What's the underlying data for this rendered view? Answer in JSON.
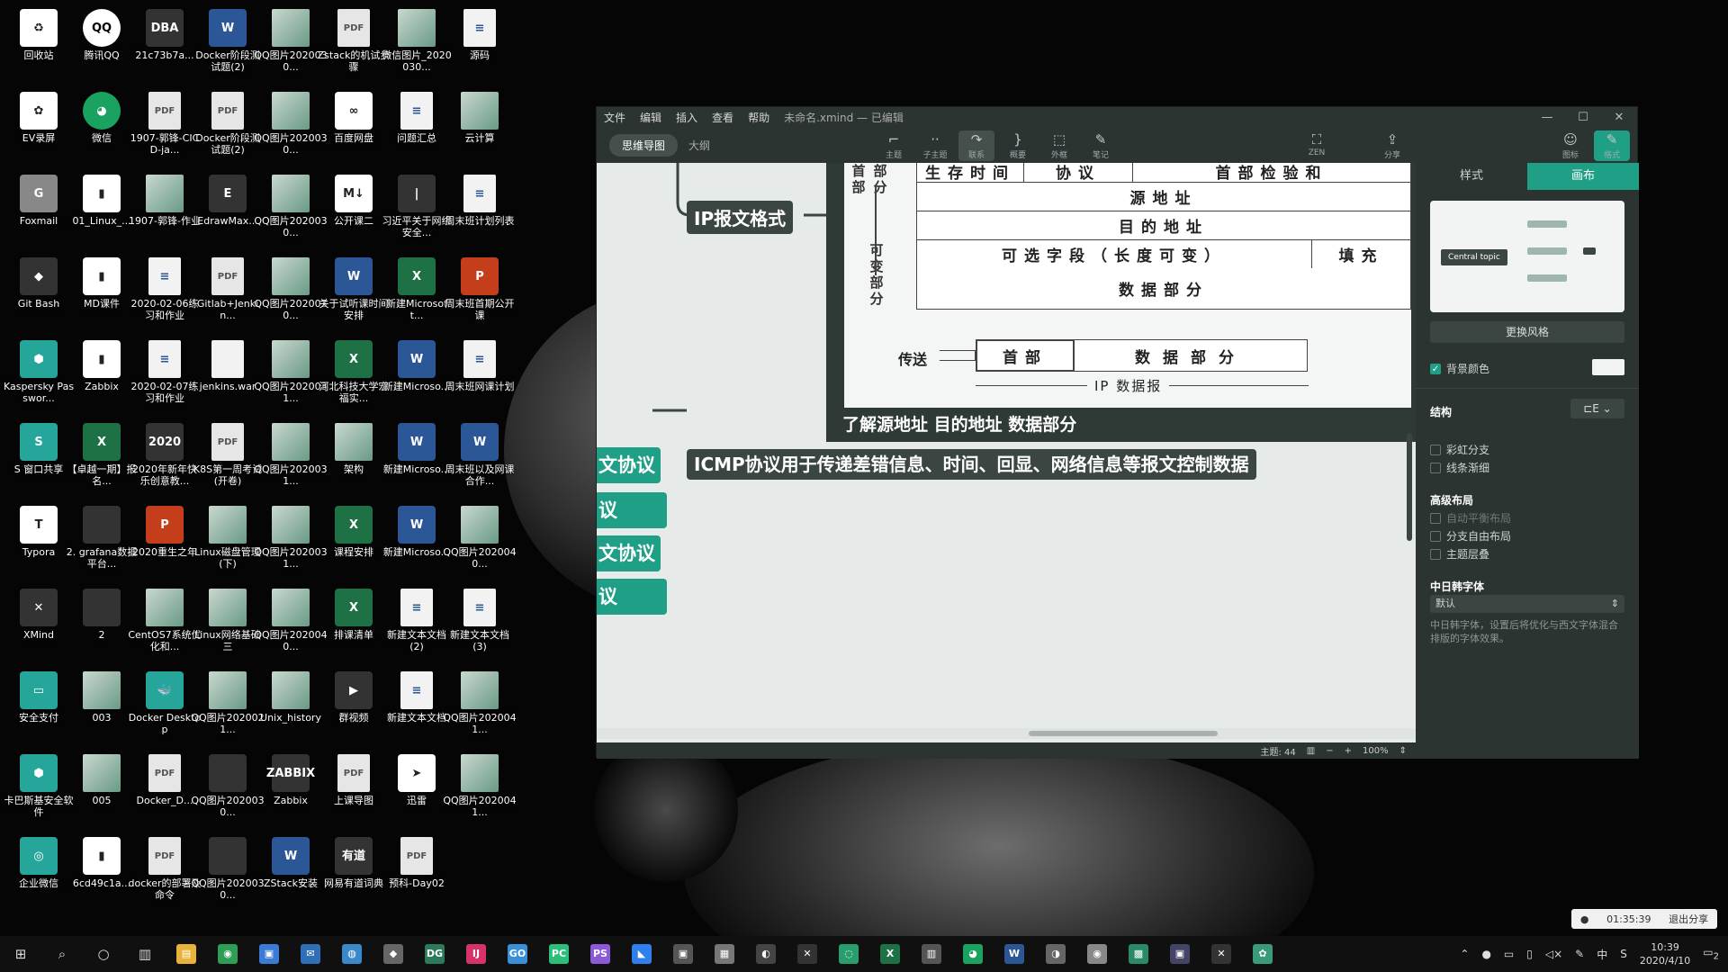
{
  "desktop_icons": [
    {
      "label": "回收站",
      "icon": "recycle-bin-icon",
      "kind": "white",
      "glyph": "♻"
    },
    {
      "label": "腾讯QQ",
      "icon": "qq-icon",
      "kind": "qq",
      "glyph": "QQ"
    },
    {
      "label": "21c73b7a...",
      "icon": "dba-icon",
      "kind": "dark",
      "glyph": "DBA"
    },
    {
      "label": "Docker阶段测试题(2)",
      "icon": "word-doc-icon",
      "kind": "word",
      "glyph": "W"
    },
    {
      "label": "QQ图片2020030...",
      "icon": "image-file-icon",
      "kind": "img",
      "glyph": ""
    },
    {
      "label": "Zstack的机试步骤",
      "icon": "pdf-icon",
      "kind": "pdf",
      "glyph": "PDF"
    },
    {
      "label": "微信图片_2020030...",
      "icon": "image-file-icon",
      "kind": "img",
      "glyph": ""
    },
    {
      "label": "源码",
      "icon": "text-file-icon",
      "kind": "doc",
      "glyph": "≡"
    },
    {
      "label": "EV录屏",
      "icon": "ev-recorder-icon",
      "kind": "white",
      "glyph": "✿"
    },
    {
      "label": "微信",
      "icon": "wechat-icon",
      "kind": "green",
      "glyph": "◕"
    },
    {
      "label": "1907-郭锋-CICD-ja...",
      "icon": "pdf-icon",
      "kind": "pdf",
      "glyph": "PDF"
    },
    {
      "label": "Docker阶段测试题(2)",
      "icon": "pdf-icon",
      "kind": "pdf",
      "glyph": "PDF"
    },
    {
      "label": "QQ图片2020030...",
      "icon": "image-file-icon",
      "kind": "img",
      "glyph": ""
    },
    {
      "label": "百度网盘",
      "icon": "baidu-netdisk-icon",
      "kind": "white",
      "glyph": "∞"
    },
    {
      "label": "问题汇总",
      "icon": "text-file-icon",
      "kind": "doc",
      "glyph": "≡"
    },
    {
      "label": "云计算",
      "icon": "image-file-icon",
      "kind": "img",
      "glyph": ""
    },
    {
      "label": "Foxmail",
      "icon": "foxmail-icon",
      "kind": "gray",
      "glyph": "G"
    },
    {
      "label": "01_Linux_...",
      "icon": "file-icon",
      "kind": "white",
      "glyph": "▮"
    },
    {
      "label": "1907-郭锋-作业",
      "icon": "image-file-icon",
      "kind": "img",
      "glyph": ""
    },
    {
      "label": "EdrawMax...",
      "icon": "edrawmax-icon",
      "kind": "dark",
      "glyph": "E"
    },
    {
      "label": "QQ图片2020030...",
      "icon": "image-file-icon",
      "kind": "img",
      "glyph": ""
    },
    {
      "label": "公开课二",
      "icon": "markdown-icon",
      "kind": "white",
      "glyph": "M↓"
    },
    {
      "label": "习近平关于网络安全...",
      "icon": "file-icon",
      "kind": "dark",
      "glyph": "|"
    },
    {
      "label": "周末班计划列表",
      "icon": "text-file-icon",
      "kind": "doc",
      "glyph": "≡"
    },
    {
      "label": "Git Bash",
      "icon": "git-bash-icon",
      "kind": "dark",
      "glyph": "◆"
    },
    {
      "label": "MD课件",
      "icon": "file-icon",
      "kind": "white",
      "glyph": "▮"
    },
    {
      "label": "2020-02-06练习和作业",
      "icon": "text-file-icon",
      "kind": "doc",
      "glyph": "≡"
    },
    {
      "label": "Gitlab+Jenkin...",
      "icon": "pdf-icon",
      "kind": "pdf",
      "glyph": "PDF"
    },
    {
      "label": "QQ图片2020030...",
      "icon": "image-file-icon",
      "kind": "img",
      "glyph": ""
    },
    {
      "label": "关于试听课时间安排",
      "icon": "word-doc-icon",
      "kind": "word",
      "glyph": "W"
    },
    {
      "label": "新建Microsoft...",
      "icon": "excel-icon",
      "kind": "excel",
      "glyph": "X"
    },
    {
      "label": "周末班首期公开课",
      "icon": "ppt-icon",
      "kind": "ppt",
      "glyph": "P"
    },
    {
      "label": "Kaspersky Passwor...",
      "icon": "kaspersky-icon",
      "kind": "teal",
      "glyph": "⬢"
    },
    {
      "label": "Zabbix",
      "icon": "file-icon",
      "kind": "white",
      "glyph": "▮"
    },
    {
      "label": "2020-02-07练习和作业",
      "icon": "text-file-icon",
      "kind": "doc",
      "glyph": "≡"
    },
    {
      "label": "jenkins.war",
      "icon": "file-icon",
      "kind": "doc",
      "glyph": ""
    },
    {
      "label": "QQ图片2020031...",
      "icon": "image-file-icon",
      "kind": "img",
      "glyph": ""
    },
    {
      "label": "河北科技大学宏福实...",
      "icon": "excel-icon",
      "kind": "excel",
      "glyph": "X"
    },
    {
      "label": "新建Microso...",
      "icon": "word-doc-icon",
      "kind": "word",
      "glyph": "W"
    },
    {
      "label": "周末班网课计划",
      "icon": "text-file-icon",
      "kind": "doc",
      "glyph": "≡"
    },
    {
      "label": "S 窗口共享",
      "icon": "share-window-icon",
      "kind": "teal",
      "glyph": "S"
    },
    {
      "label": "【卓越一期】报名...",
      "icon": "excel-icon",
      "kind": "excel",
      "glyph": "X"
    },
    {
      "label": "2020年新年快乐创意教...",
      "icon": "image-file-icon",
      "kind": "dark",
      "glyph": "2020"
    },
    {
      "label": "K8S第一周考试(开卷)",
      "icon": "pdf-icon",
      "kind": "pdf",
      "glyph": "PDF"
    },
    {
      "label": "QQ图片2020031...",
      "icon": "image-file-icon",
      "kind": "img",
      "glyph": ""
    },
    {
      "label": "架构",
      "icon": "image-file-icon",
      "kind": "img",
      "glyph": ""
    },
    {
      "label": "新建Microso...",
      "icon": "word-doc-icon",
      "kind": "word",
      "glyph": "W"
    },
    {
      "label": "周末班以及网课合作...",
      "icon": "word-doc-icon",
      "kind": "word",
      "glyph": "W"
    },
    {
      "label": "Typora",
      "icon": "typora-icon",
      "kind": "white",
      "glyph": "T"
    },
    {
      "label": "2. grafana数据平台...",
      "icon": "image-file-icon",
      "kind": "dark",
      "glyph": ""
    },
    {
      "label": "2020重生之年",
      "icon": "ppt-icon",
      "kind": "ppt",
      "glyph": "P"
    },
    {
      "label": "Linux磁盘管理(下)",
      "icon": "image-file-icon",
      "kind": "img",
      "glyph": ""
    },
    {
      "label": "QQ图片2020031...",
      "icon": "image-file-icon",
      "kind": "img",
      "glyph": ""
    },
    {
      "label": "课程安排",
      "icon": "excel-icon",
      "kind": "excel",
      "glyph": "X"
    },
    {
      "label": "新建Microso...",
      "icon": "word-doc-icon",
      "kind": "word",
      "glyph": "W"
    },
    {
      "label": "QQ图片2020040...",
      "icon": "image-file-icon",
      "kind": "img",
      "glyph": ""
    },
    {
      "label": "XMind",
      "icon": "xmind-icon",
      "kind": "dark",
      "glyph": "✕"
    },
    {
      "label": "2",
      "icon": "image-file-icon",
      "kind": "dark",
      "glyph": ""
    },
    {
      "label": "CentOS7系统优化和...",
      "icon": "image-file-icon",
      "kind": "img",
      "glyph": ""
    },
    {
      "label": "Linux网络基础三",
      "icon": "image-file-icon",
      "kind": "img",
      "glyph": ""
    },
    {
      "label": "QQ图片2020040...",
      "icon": "image-file-icon",
      "kind": "img",
      "glyph": ""
    },
    {
      "label": "排课清单",
      "icon": "excel-icon",
      "kind": "excel",
      "glyph": "X"
    },
    {
      "label": "新建文本文档 (2)",
      "icon": "text-file-icon",
      "kind": "doc",
      "glyph": "≡"
    },
    {
      "label": "新建文本文档 (3)",
      "icon": "text-file-icon",
      "kind": "doc",
      "glyph": "≡"
    },
    {
      "label": "安全支付",
      "icon": "secure-pay-icon",
      "kind": "teal",
      "glyph": "▭"
    },
    {
      "label": "003",
      "icon": "image-file-icon",
      "kind": "img",
      "glyph": ""
    },
    {
      "label": "Docker Desktop",
      "icon": "docker-icon",
      "kind": "teal",
      "glyph": "🐳"
    },
    {
      "label": "QQ图片2020021...",
      "icon": "image-file-icon",
      "kind": "img",
      "glyph": ""
    },
    {
      "label": "Unix_history",
      "icon": "image-file-icon",
      "kind": "img",
      "glyph": ""
    },
    {
      "label": "群视频",
      "icon": "video-icon",
      "kind": "dark",
      "glyph": "▶"
    },
    {
      "label": "新建文本文档",
      "icon": "text-file-icon",
      "kind": "doc",
      "glyph": "≡"
    },
    {
      "label": "QQ图片2020041...",
      "icon": "image-file-icon",
      "kind": "img",
      "glyph": ""
    },
    {
      "label": "卡巴斯基安全软件",
      "icon": "kaspersky-icon",
      "kind": "teal",
      "glyph": "⬢"
    },
    {
      "label": "005",
      "icon": "image-file-icon",
      "kind": "img",
      "glyph": ""
    },
    {
      "label": "Docker_D...",
      "icon": "pdf-icon",
      "kind": "pdf",
      "glyph": "PDF"
    },
    {
      "label": "QQ图片2020030...",
      "icon": "image-file-icon",
      "kind": "dark",
      "glyph": ""
    },
    {
      "label": "Zabbix",
      "icon": "zabbix-icon",
      "kind": "dark",
      "glyph": "ZABBIX"
    },
    {
      "label": "上课导图",
      "icon": "pdf-icon",
      "kind": "pdf",
      "glyph": "PDF"
    },
    {
      "label": "迅雷",
      "icon": "thunder-icon",
      "kind": "white",
      "glyph": "➤"
    },
    {
      "label": "QQ图片2020041...",
      "icon": "image-file-icon",
      "kind": "img",
      "glyph": ""
    },
    {
      "label": "企业微信",
      "icon": "wework-icon",
      "kind": "teal",
      "glyph": "◎"
    },
    {
      "label": "6cd49c1a...",
      "icon": "file-icon",
      "kind": "white",
      "glyph": "▮"
    },
    {
      "label": "docker的部署及命令",
      "icon": "pdf-icon",
      "kind": "pdf",
      "glyph": "PDF"
    },
    {
      "label": "QQ图片2020030...",
      "icon": "image-file-icon",
      "kind": "dark",
      "glyph": ""
    },
    {
      "label": "ZStack安装",
      "icon": "word-doc-icon",
      "kind": "word",
      "glyph": "W"
    },
    {
      "label": "网易有道词典",
      "icon": "youdao-icon",
      "kind": "dark",
      "glyph": "有道"
    },
    {
      "label": "预科-Day02",
      "icon": "pdf-icon",
      "kind": "pdf",
      "glyph": "PDF"
    }
  ],
  "window": {
    "menus": [
      "文件",
      "编辑",
      "插入",
      "查看",
      "帮助"
    ],
    "title": "未命名.xmind — 已编辑",
    "tabs": {
      "mindmap": "思维导图",
      "outline": "大纲"
    },
    "tools": [
      {
        "label": "主题",
        "glyph": "⌐"
      },
      {
        "label": "子主题",
        "glyph": "··"
      },
      {
        "label": "联系",
        "glyph": "↷"
      },
      {
        "label": "概要",
        "glyph": "}"
      },
      {
        "label": "外框",
        "glyph": "⬚"
      },
      {
        "label": "笔记",
        "glyph": "✎"
      }
    ],
    "zen_label": "ZEN",
    "share_label": "分享",
    "icons_label": "图标",
    "format_label": "格式"
  },
  "canvas": {
    "ip_format_node": "IP报文格式",
    "table": {
      "row1": [
        "生存时间",
        "协议",
        "首部检验和"
      ],
      "row2": "源地址",
      "row3": "目的地址",
      "row4": [
        "可选字段（长度可变）",
        "填充"
      ],
      "row5": "数据部分",
      "header_side": "首部",
      "fixed_side": "部分",
      "variable_side": "可变部分",
      "send_label": "传送",
      "dg_header": "首部",
      "dg_data": "数据部分",
      "dg_caption": "IP 数据报"
    },
    "image_caption": "了解源地址 目的地址 数据部分",
    "icmp_node": "ICMP协议用于传递差错信息、时间、回显、网络信息等报文控制数据",
    "green_nodes": [
      "文协议",
      "议",
      "文协议",
      "议"
    ]
  },
  "statusbar": {
    "topics": "主题: 44",
    "zoom": "100%"
  },
  "panel": {
    "tab_style": "样式",
    "tab_canvas": "画布",
    "thumb_central": "Central topic",
    "change_style": "更换风格",
    "bg_color": "背景颜色",
    "structure": "结构",
    "rainbow": "彩虹分支",
    "taper": "线条渐细",
    "advanced": "高级布局",
    "auto_balance": "自动平衡布局",
    "free_layout": "分支自由布局",
    "overlap": "主题层叠",
    "cjk_font": "中日韩字体",
    "font_default": "默认",
    "font_desc": "中日韩字体，设置后将优化与西文字体混合排版的字体效果。"
  },
  "recording": {
    "time": "01:35:39",
    "exit": "退出分享"
  },
  "taskbar": {
    "apps": [
      {
        "name": "file-explorer",
        "glyph": "▤",
        "color": "#e8b33a"
      },
      {
        "name": "chrome",
        "glyph": "◉",
        "color": "#2e9d55"
      },
      {
        "name": "store",
        "glyph": "▣",
        "color": "#3a7bd5"
      },
      {
        "name": "mail",
        "glyph": "✉",
        "color": "#2f6fb5"
      },
      {
        "name": "browser",
        "glyph": "◍",
        "color": "#3a89c9"
      },
      {
        "name": "app-a",
        "glyph": "◆",
        "color": "#666"
      },
      {
        "name": "datagrip",
        "glyph": "DG",
        "color": "#2c7a5a"
      },
      {
        "name": "intellij",
        "glyph": "IJ",
        "color": "#d6336c"
      },
      {
        "name": "goland",
        "glyph": "GO",
        "color": "#3a8fd6"
      },
      {
        "name": "pycharm",
        "glyph": "PC",
        "color": "#2cbf7a"
      },
      {
        "name": "phpstorm",
        "glyph": "PS",
        "color": "#8c5ad6"
      },
      {
        "name": "vscode",
        "glyph": "◣",
        "color": "#2f80ed"
      },
      {
        "name": "app-b",
        "glyph": "▣",
        "color": "#555"
      },
      {
        "name": "app-c",
        "glyph": "▦",
        "color": "#777"
      },
      {
        "name": "app-d",
        "glyph": "◐",
        "color": "#444"
      },
      {
        "name": "xmind",
        "glyph": "✕",
        "color": "#333"
      },
      {
        "name": "app-e",
        "glyph": "◌",
        "color": "#2a9d6f"
      },
      {
        "name": "excel",
        "glyph": "X",
        "color": "#1e7145"
      },
      {
        "name": "app-f",
        "glyph": "▥",
        "color": "#555"
      },
      {
        "name": "wechat",
        "glyph": "◕",
        "color": "#1aa260"
      },
      {
        "name": "word",
        "glyph": "W",
        "color": "#2b5797"
      },
      {
        "name": "app-g",
        "glyph": "◑",
        "color": "#666"
      },
      {
        "name": "app-h",
        "glyph": "◉",
        "color": "#888"
      },
      {
        "name": "app-i",
        "glyph": "▩",
        "color": "#2a8a66"
      },
      {
        "name": "app-j",
        "glyph": "▣",
        "color": "#446"
      },
      {
        "name": "app-k",
        "glyph": "✕",
        "color": "#333"
      },
      {
        "name": "app-l",
        "glyph": "✿",
        "color": "#3a9a7a"
      }
    ],
    "time": "10:39",
    "date": "2020/4/10",
    "ime": "中",
    "notification_count": "2"
  }
}
